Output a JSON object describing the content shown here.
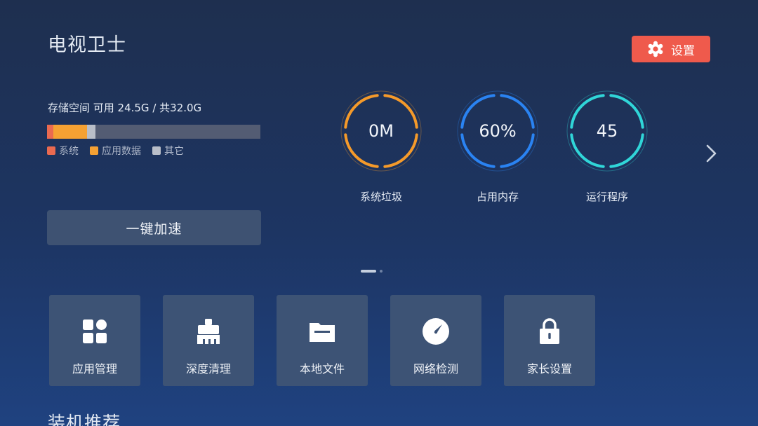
{
  "app": {
    "title": "电视卫士"
  },
  "settings": {
    "label": "设置",
    "icon": "gear-icon"
  },
  "storage": {
    "label": "存储空间 可用 24.5G / 共32.0G",
    "segments": [
      {
        "key": "system",
        "fraction": 0.03,
        "color": "#ea6a50"
      },
      {
        "key": "app_data",
        "fraction": 0.157,
        "color": "#f5a133"
      },
      {
        "key": "other",
        "fraction": 0.04,
        "color": "#b9bec8"
      }
    ],
    "legend": [
      {
        "label": "系统",
        "color": "#ea6a50"
      },
      {
        "label": "应用数据",
        "color": "#f5a133"
      },
      {
        "label": "其它",
        "color": "#b9bec8"
      }
    ]
  },
  "boost": {
    "label": "一键加速"
  },
  "gauges": [
    {
      "value": "0M",
      "label": "系统垃圾",
      "color": "#f59a2a",
      "inner": "#1f3154"
    },
    {
      "value": "60%",
      "label": "占用内存",
      "color": "#2a83f2",
      "inner": "#1f3154"
    },
    {
      "value": "45",
      "label": "运行程序",
      "color": "#30d6d8",
      "inner": "#1f3154"
    }
  ],
  "pager": {
    "current": 1,
    "total": 2
  },
  "tools": [
    {
      "label": "应用管理",
      "icon": "apps-grid-icon"
    },
    {
      "label": "深度清理",
      "icon": "brush-icon"
    },
    {
      "label": "本地文件",
      "icon": "folder-icon"
    },
    {
      "label": "网络检测",
      "icon": "speedometer-icon"
    },
    {
      "label": "家长设置",
      "icon": "lock-icon"
    }
  ],
  "recommend": {
    "title": "装机推荐"
  }
}
